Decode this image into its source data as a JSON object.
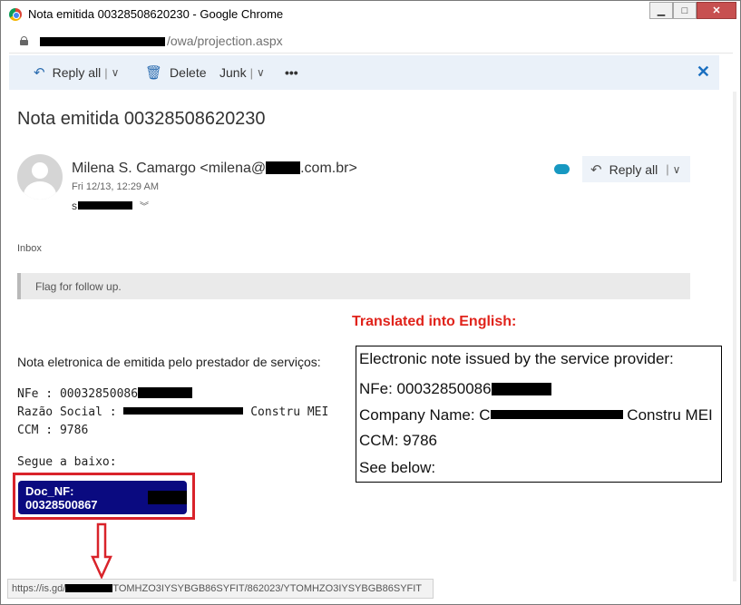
{
  "window": {
    "title": "Nota emitida 00328508620230 - Google Chrome",
    "minimize": "▁",
    "maximize": "□",
    "close": "✕"
  },
  "address": {
    "url_path": "/owa/projection.aspx"
  },
  "toolbar": {
    "reply_all": "Reply all",
    "delete": "Delete",
    "junk": "Junk",
    "more": "•••",
    "close": "✕"
  },
  "message": {
    "subject": "Nota emitida 00328508620230",
    "sender_name_start": "Milena S. Camargo <milena@",
    "sender_domain_end": ".com.br>",
    "date": "Fri 12/13, 12:29 AM",
    "to_prefix": "s",
    "reply_all": "Reply all",
    "folder": "Inbox",
    "flag_text": "Flag for follow up."
  },
  "body": {
    "intro": "Nota eletronica de emitida pelo prestador de serviços:",
    "nfe_label": "NFe : 00032850086",
    "razao_label": "Razão Social : ",
    "razao_suffix": " Constru MEI",
    "ccm": "CCM : 9786",
    "segue": "Segue a baixo:",
    "doc_button": "Doc_NF: 00328500867"
  },
  "annotation": {
    "heading": "Translated into English:",
    "lines": {
      "line1": "Electronic note issued by the service provider:",
      "line2": "NFe: 00032850086",
      "line3_prefix": "Company Name: C",
      "line3_suffix": " Constru MEI",
      "line4": "CCM: 9786",
      "line5": "See below:"
    },
    "outline_color": "#d9232a"
  },
  "statusbar": {
    "url_start": "https://is.gd/",
    "url_end": "TOMHZO3IYSYBGB86SYFIT/862023/YTOMHZO3IYSYBGB86SYFIT"
  },
  "colors": {
    "accent": "#1a6fc0",
    "doc_button_bg": "#0a0a80",
    "annotation_red": "#e0231b"
  }
}
